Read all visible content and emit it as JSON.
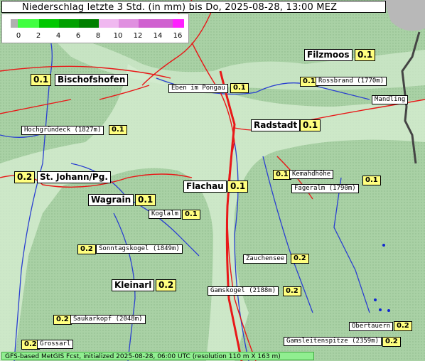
{
  "title": "Niederschlag letzte 3 Std. (in mm) bis Do, 2025-08-28, 13:00 MEZ",
  "legend": {
    "ticks": [
      "0",
      "2",
      "4",
      "6",
      "8",
      "10",
      "12",
      "14",
      "16"
    ],
    "colors": [
      "#b0b0b0",
      "#40ff40",
      "#00c800",
      "#00a000",
      "#008000",
      "#f0b8f0",
      "#e090e0",
      "#d060d0",
      "#ff20ff"
    ]
  },
  "places": [
    {
      "name": "Filzmoos",
      "value": "0.1",
      "big": true
    },
    {
      "name": "Bischofshofen",
      "value": "0.1",
      "big": true
    },
    {
      "name": "Eben im Pongau",
      "value": "0.1",
      "big": false
    },
    {
      "name": "Rossbrand (1770m)",
      "value": "0.1",
      "big": false
    },
    {
      "name": "Mandling",
      "value": "",
      "big": false
    },
    {
      "name": "Radstadt",
      "value": "0.1",
      "big": true
    },
    {
      "name": "Hochgründeck (1827m)",
      "value": "0.1",
      "big": false
    },
    {
      "name": "St. Johann/Pg.",
      "value": "0.2",
      "big": true
    },
    {
      "name": "Kemahdhöhe",
      "value": "0.1",
      "big": false
    },
    {
      "name": "Fageralm (1790m)",
      "value": "0.1",
      "big": false
    },
    {
      "name": "Flachau",
      "value": "0.1",
      "big": true
    },
    {
      "name": "Wagrain",
      "value": "0.1",
      "big": true
    },
    {
      "name": "Koglalm",
      "value": "0.1",
      "big": false
    },
    {
      "name": "Sonntagskogel (1849m)",
      "value": "0.2",
      "big": false
    },
    {
      "name": "Zauchensee",
      "value": "0.2",
      "big": false
    },
    {
      "name": "Kleinarl",
      "value": "0.2",
      "big": true
    },
    {
      "name": "Gamskogel (2188m)",
      "value": "0.2",
      "big": false
    },
    {
      "name": "Saukarkopf (2048m)",
      "value": "0.2",
      "big": false
    },
    {
      "name": "Obertauern",
      "value": "0.2",
      "big": false
    },
    {
      "name": "Grossarl",
      "value": "0.2",
      "big": false
    },
    {
      "name": "Gamsleitenspitze (2359m)",
      "value": "0.2",
      "big": false
    }
  ],
  "footer": "GFS-based MetGIS Fcst, initialized 2025-08-28, 06:00 UTC  (resolution 110 m X 163 m)"
}
